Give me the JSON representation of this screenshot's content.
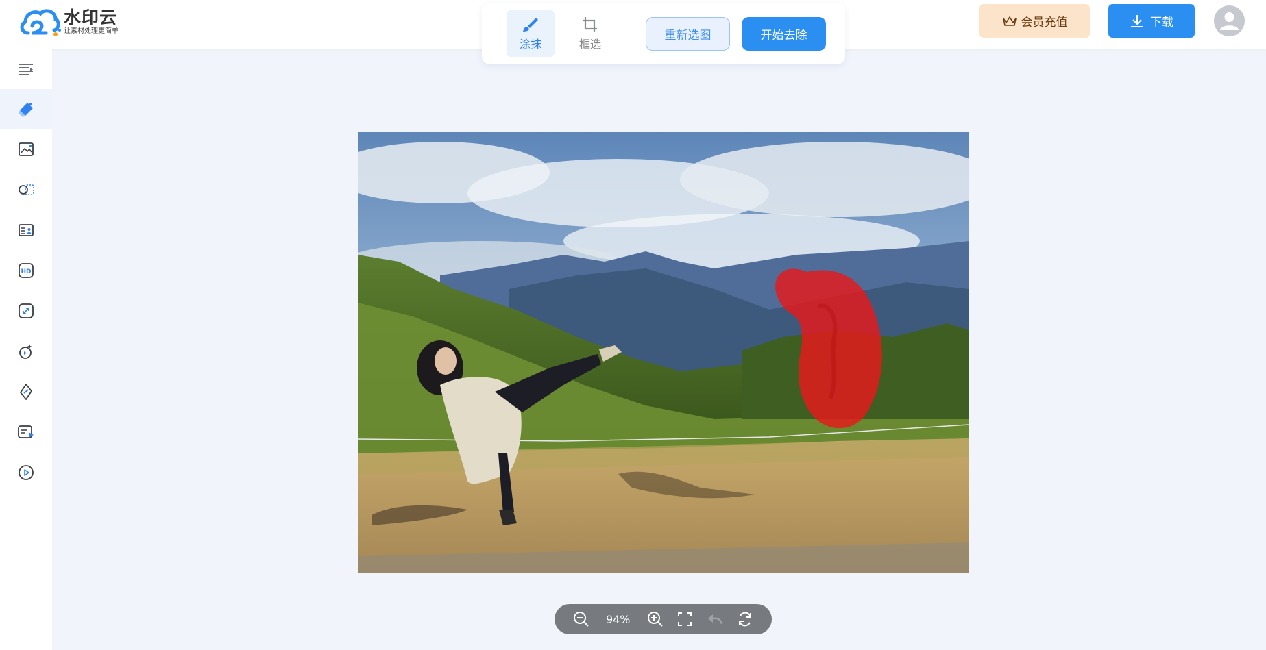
{
  "app": {
    "name": "水印云",
    "tagline": "让素材处理更简单"
  },
  "toolbar": {
    "tools": [
      {
        "label": "涂抹",
        "icon": "brush-icon",
        "active": true
      },
      {
        "label": "框选",
        "icon": "crop-icon",
        "active": false
      }
    ],
    "reselect_label": "重新选图",
    "start_label": "开始去除"
  },
  "header": {
    "vip_label": "会员充值",
    "download_label": "下载"
  },
  "sidebar": {
    "items": [
      {
        "icon": "menu-collapse-icon",
        "active": false
      },
      {
        "icon": "eraser-icon",
        "active": true
      },
      {
        "icon": "image-edit-icon",
        "active": false
      },
      {
        "icon": "cutout-icon",
        "active": false
      },
      {
        "icon": "id-card-icon",
        "active": false
      },
      {
        "icon": "hd-icon",
        "active": false
      },
      {
        "icon": "expand-icon",
        "active": false
      },
      {
        "icon": "magic-repair-icon",
        "active": false
      },
      {
        "icon": "link-icon",
        "active": false
      },
      {
        "icon": "video-text-icon",
        "active": false
      },
      {
        "icon": "play-icon",
        "active": false
      }
    ]
  },
  "zoom": {
    "level": "94%"
  },
  "colors": {
    "accent": "#2b8ff2",
    "vip_bg": "#fbe4c9",
    "mask": "#e8191b"
  }
}
